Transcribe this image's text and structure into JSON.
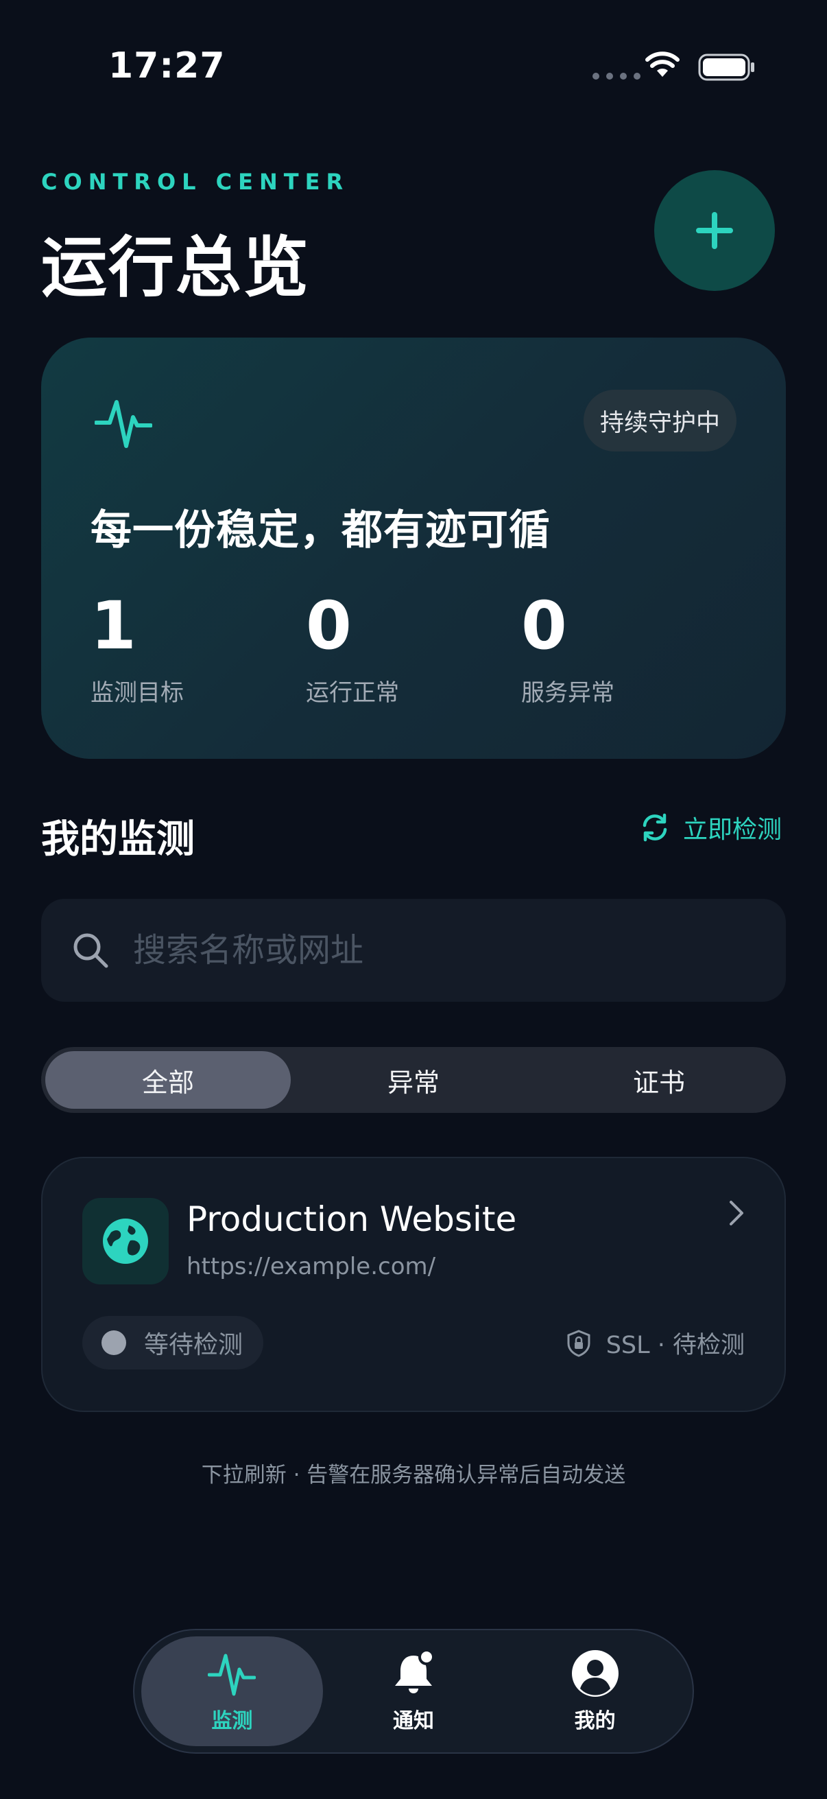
{
  "status_bar": {
    "time": "17:27"
  },
  "header": {
    "eyebrow": "CONTROL CENTER",
    "title": "运行总览",
    "add_icon": "plus-icon"
  },
  "hero": {
    "icon": "pulse-icon",
    "badge": "持续守护中",
    "slogan": "每一份稳定，都有迹可循",
    "stats": [
      {
        "value": "1",
        "label": "监测目标"
      },
      {
        "value": "0",
        "label": "运行正常"
      },
      {
        "value": "0",
        "label": "服务异常"
      }
    ]
  },
  "section": {
    "title": "我的监测",
    "action_label": "立即检测",
    "action_icon": "refresh-icon"
  },
  "search": {
    "placeholder": "搜索名称或网址",
    "value": ""
  },
  "filter_tabs": [
    {
      "label": "全部",
      "active": true
    },
    {
      "label": "异常",
      "active": false
    },
    {
      "label": "证书",
      "active": false
    }
  ],
  "monitors": [
    {
      "name": "Production Website",
      "url": "https://example.com/",
      "icon": "globe-icon",
      "status": "等待检测",
      "ssl": "SSL · 待检测"
    }
  ],
  "footnote": "下拉刷新 · 告警在服务器确认异常后自动发送",
  "bottom_nav": [
    {
      "label": "监测",
      "icon": "pulse-icon",
      "active": true
    },
    {
      "label": "通知",
      "icon": "bell-icon",
      "active": false
    },
    {
      "label": "我的",
      "icon": "user-icon",
      "active": false
    }
  ],
  "colors": {
    "background": "#0a0f1a",
    "accent": "#2dd4bf",
    "card": "#121a26"
  }
}
